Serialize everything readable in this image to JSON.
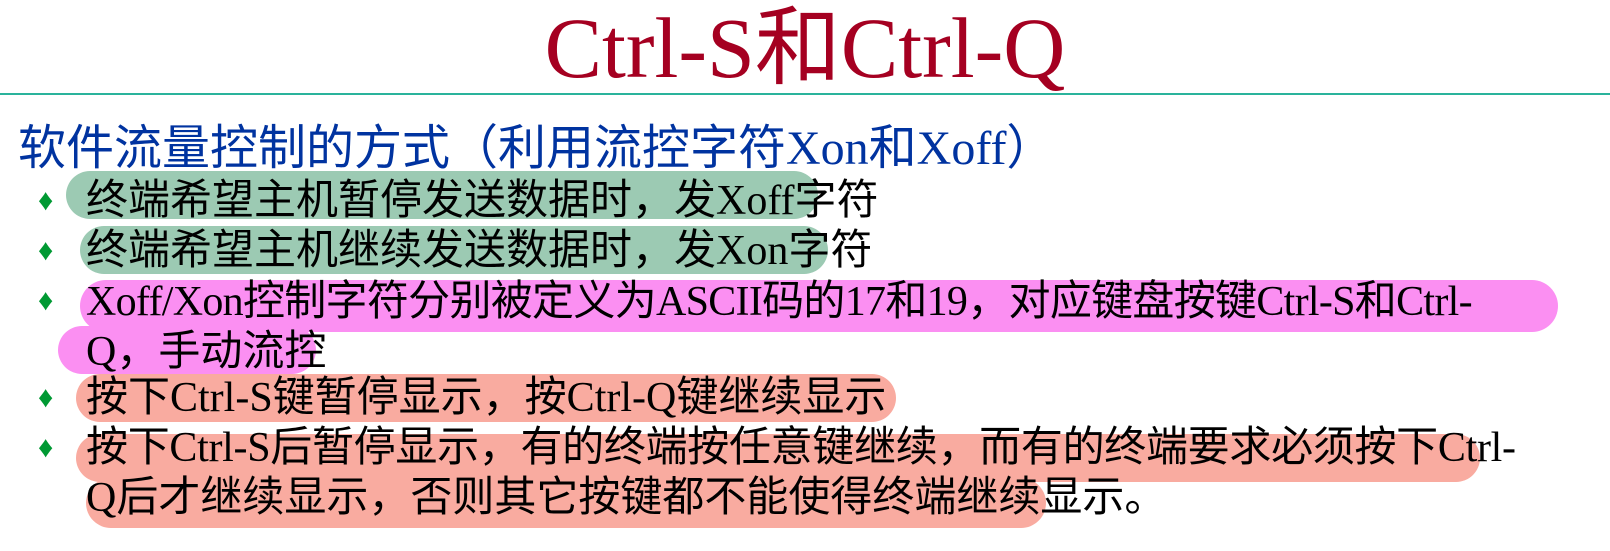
{
  "title": "Ctrl-S和Ctrl-Q",
  "subheading": "软件流量控制的方式（利用流控字符Xon和Xoff）",
  "bullet_glyph": "♦",
  "bullets": [
    {
      "lines": [
        "终端希望主机暂停发送数据时，发Xoff字符"
      ]
    },
    {
      "lines": [
        "终端希望主机继续发送数据时，发Xon字符"
      ]
    },
    {
      "lines": [
        "Xoff/Xon控制字符分别被定义为ASCII码的17和19，对应键盘按键Ctrl-S和Ctrl-",
        "Q，手动流控"
      ]
    },
    {
      "lines": [
        "按下Ctrl-S键暂停显示，按Ctrl-Q键继续显示"
      ]
    },
    {
      "lines": [
        "按下Ctrl-S后暂停显示，有的终端按任意键继续，而有的终端要求必须按下Ctrl-",
        "Q后才继续显示，否则其它按键都不能使得终端继续显示。"
      ]
    }
  ],
  "colors": {
    "title": "#a50021",
    "rule": "#2ab39c",
    "subheading": "#0033a0",
    "bullet": "#009933",
    "highlight_green": "#9ccab3",
    "highlight_magenta": "#fb8ff2",
    "highlight_salmon": "#f9aba0"
  }
}
